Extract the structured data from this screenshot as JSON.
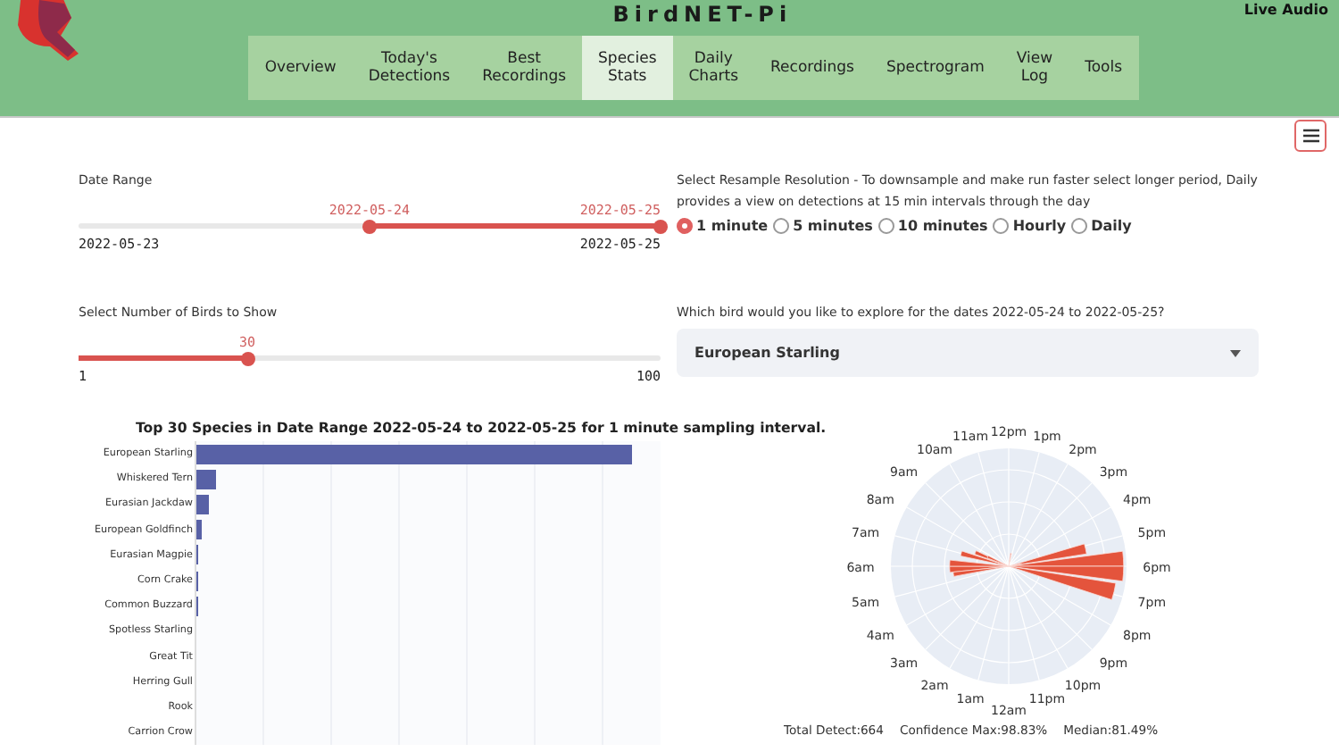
{
  "header": {
    "title": "BirdNET-Pi",
    "live_audio": "Live Audio"
  },
  "nav": [
    {
      "label": "Overview",
      "selected": false
    },
    {
      "label": "Today's Detections",
      "selected": false
    },
    {
      "label": "Best Recordings",
      "selected": false
    },
    {
      "label": "Species Stats",
      "selected": true
    },
    {
      "label": "Daily Charts",
      "selected": false
    },
    {
      "label": "Recordings",
      "selected": false
    },
    {
      "label": "Spectrogram",
      "selected": false
    },
    {
      "label": "View Log",
      "selected": false
    },
    {
      "label": "Tools",
      "selected": false
    }
  ],
  "date_range": {
    "label": "Date Range",
    "min": "2022-05-23",
    "max": "2022-05-25",
    "low": {
      "value": "2022-05-24",
      "level": 0.5
    },
    "high": {
      "value": "2022-05-25",
      "level": 1
    }
  },
  "bird_count": {
    "label": "Select Number of Birds to Show",
    "value": "30",
    "level": 0.29,
    "min": "1",
    "max": "100"
  },
  "resample": {
    "label": "Select Resample Resolution - To downsample and make run faster select longer period, Daily provides a view on detections at 15 min intervals through the day",
    "options": [
      {
        "label": "1 minute",
        "selected": true
      },
      {
        "label": "5 minutes",
        "selected": false
      },
      {
        "label": "10 minutes",
        "selected": false
      },
      {
        "label": "Hourly",
        "selected": false
      },
      {
        "label": "Daily",
        "selected": false
      }
    ]
  },
  "bird_select": {
    "label": "Which bird would you like to explore for the dates 2022-05-24 to 2022-05-25?",
    "value": "European Starling"
  },
  "bar_chart": {
    "title": "Top 30 Species in Date Range 2022-05-24 to 2022-05-25 for 1 minute sampling interval.",
    "species": [
      "European Starling",
      "Whiskered Tern",
      "Eurasian Jackdaw",
      "European Goldfinch",
      "Eurasian Magpie",
      "Corn Crake",
      "Common Buzzard",
      "Spotless Starling",
      "Great Tit",
      "Herring Gull",
      "Rook",
      "Carrion Crow"
    ]
  },
  "polar_chart": {
    "hour_labels_right": [
      "12pm",
      "1pm",
      "2pm",
      "3pm",
      "4pm",
      "5pm",
      "6pm",
      "7pm",
      "8pm",
      "9pm",
      "10pm",
      "11pm",
      "12am"
    ],
    "hour_labels_left": [
      "11am",
      "10am",
      "9am",
      "8am",
      "7am",
      "6am",
      "5am",
      "4am",
      "3am",
      "2am",
      "1am"
    ],
    "stats": [
      "Total Detect:664",
      "Confidence Max:98.83%",
      "Median:81.49%"
    ]
  }
}
